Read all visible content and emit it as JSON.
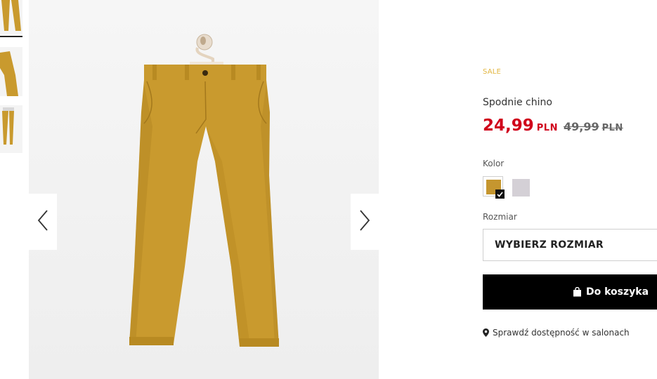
{
  "gallery": {
    "thumbnails": [
      "thumb-front",
      "thumb-side",
      "thumb-back"
    ],
    "selected_thumbnail": 0,
    "prev_icon": "chevron-left-icon",
    "next_icon": "chevron-right-icon"
  },
  "product": {
    "badge": "SALE",
    "name": "Spodnie chino",
    "price_new": "24,99",
    "currency_new": "PLN",
    "price_old": "49,99",
    "currency_old": "PLN",
    "color_label": "Kolor",
    "colors": [
      {
        "hex": "#c5962f",
        "selected": true
      },
      {
        "hex": "#d4d0d6",
        "selected": false
      }
    ],
    "size_label": "Rozmiar",
    "size_placeholder": "WYBIERZ ROZMIAR",
    "cart_button": "Do koszyka",
    "cart_icon": "shopping-bag-icon",
    "availability_link": "Sprawdź dostępność w salonach",
    "availability_icon": "map-pin-icon"
  },
  "colors": {
    "sale": "#e2b53e",
    "price": "#d0021b",
    "button_bg": "#000000",
    "product": "#c99a2e"
  }
}
